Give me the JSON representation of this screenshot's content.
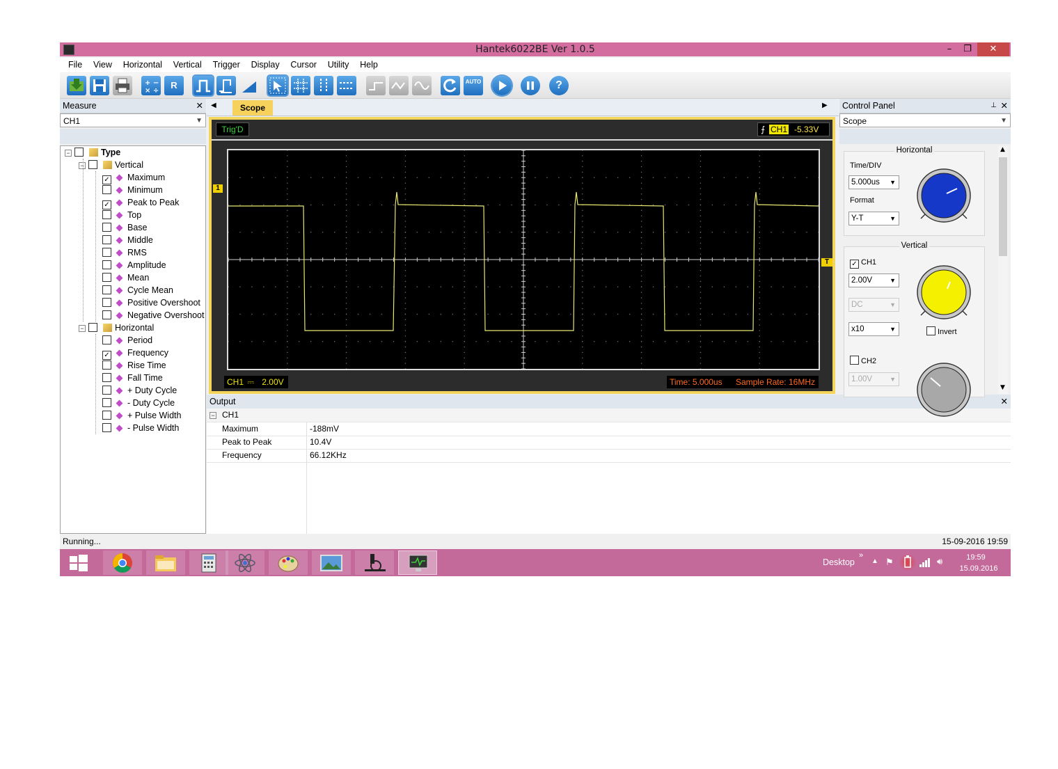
{
  "window": {
    "title": "Hantek6022BE Ver 1.0.5",
    "minimize": "–",
    "restore": "❐",
    "close": "✕"
  },
  "menu": [
    "File",
    "View",
    "Horizontal",
    "Vertical",
    "Trigger",
    "Display",
    "Cursor",
    "Utility",
    "Help"
  ],
  "toolbar": {
    "r_label": "R",
    "auto_label": "AUTO"
  },
  "measure": {
    "header": "Measure",
    "close": "✕",
    "channel": "CH1",
    "tree": {
      "root": "Type",
      "vertical_label": "Vertical",
      "vertical_items": [
        {
          "label": "Maximum",
          "checked": true
        },
        {
          "label": "Minimum",
          "checked": false
        },
        {
          "label": "Peak to Peak",
          "checked": true
        },
        {
          "label": "Top",
          "checked": false
        },
        {
          "label": "Base",
          "checked": false
        },
        {
          "label": "Middle",
          "checked": false
        },
        {
          "label": "RMS",
          "checked": false
        },
        {
          "label": "Amplitude",
          "checked": false
        },
        {
          "label": "Mean",
          "checked": false
        },
        {
          "label": "Cycle Mean",
          "checked": false
        },
        {
          "label": "Positive Overshoot",
          "checked": false
        },
        {
          "label": "Negative Overshoot",
          "checked": false
        }
      ],
      "horizontal_label": "Horizontal",
      "horizontal_items": [
        {
          "label": "Period",
          "checked": false
        },
        {
          "label": "Frequency",
          "checked": true
        },
        {
          "label": "Rise Time",
          "checked": false
        },
        {
          "label": "Fall Time",
          "checked": false
        },
        {
          "label": "+ Duty Cycle",
          "checked": false
        },
        {
          "label": "- Duty Cycle",
          "checked": false
        },
        {
          "label": "+ Pulse Width",
          "checked": false
        },
        {
          "label": "- Pulse Width",
          "checked": false
        }
      ]
    }
  },
  "scope": {
    "tab_label": "Scope",
    "trig_status": "Trig'D",
    "trig_channel": "CH1",
    "trig_level": "-5.33V",
    "ch_label": "CH1",
    "ch_coupling_symbol": "⎓",
    "ch_scale": "2.00V",
    "time_readout": "Time: 5.000us",
    "sample_rate": "Sample Rate: 16MHz",
    "ch_marker": "1",
    "trig_marker": "T"
  },
  "output": {
    "header": "Output",
    "close": "✕",
    "group": "CH1",
    "rows": [
      {
        "name": "Maximum",
        "value": "-188mV"
      },
      {
        "name": "Peak to Peak",
        "value": "10.4V"
      },
      {
        "name": "Frequency",
        "value": "66.12KHz"
      }
    ]
  },
  "control_panel": {
    "header": "Control Panel",
    "pin": "📌",
    "close": "✕",
    "mode": "Scope",
    "horizontal": {
      "title": "Horizontal",
      "time_div_label": "Time/DIV",
      "time_div": "5.000us",
      "format_label": "Format",
      "format": "Y-T",
      "knob_color": "#1538c8"
    },
    "vertical": {
      "title": "Vertical",
      "ch1_label": "CH1",
      "ch1_checked": true,
      "ch1_volts": "2.00V",
      "ch1_coupling": "DC",
      "ch1_probe": "x10",
      "invert_label": "Invert",
      "ch1_knob_color": "#f5f000",
      "ch2_label": "CH2",
      "ch2_checked": false,
      "ch2_volts": "1.00V",
      "ch2_knob_color": "#a8a8a8"
    }
  },
  "status": {
    "text": "Running...",
    "datetime": "15-09-2016  19:59"
  },
  "taskbar": {
    "desktop_label": "Desktop",
    "chevron": "»",
    "time": "19:59",
    "date": "15.09.2016"
  },
  "colors": {
    "title_bar": "#d36c9f",
    "taskbar": "#c46a9a",
    "trace": "#e8e870",
    "scope_frame": "#f2d55a"
  }
}
